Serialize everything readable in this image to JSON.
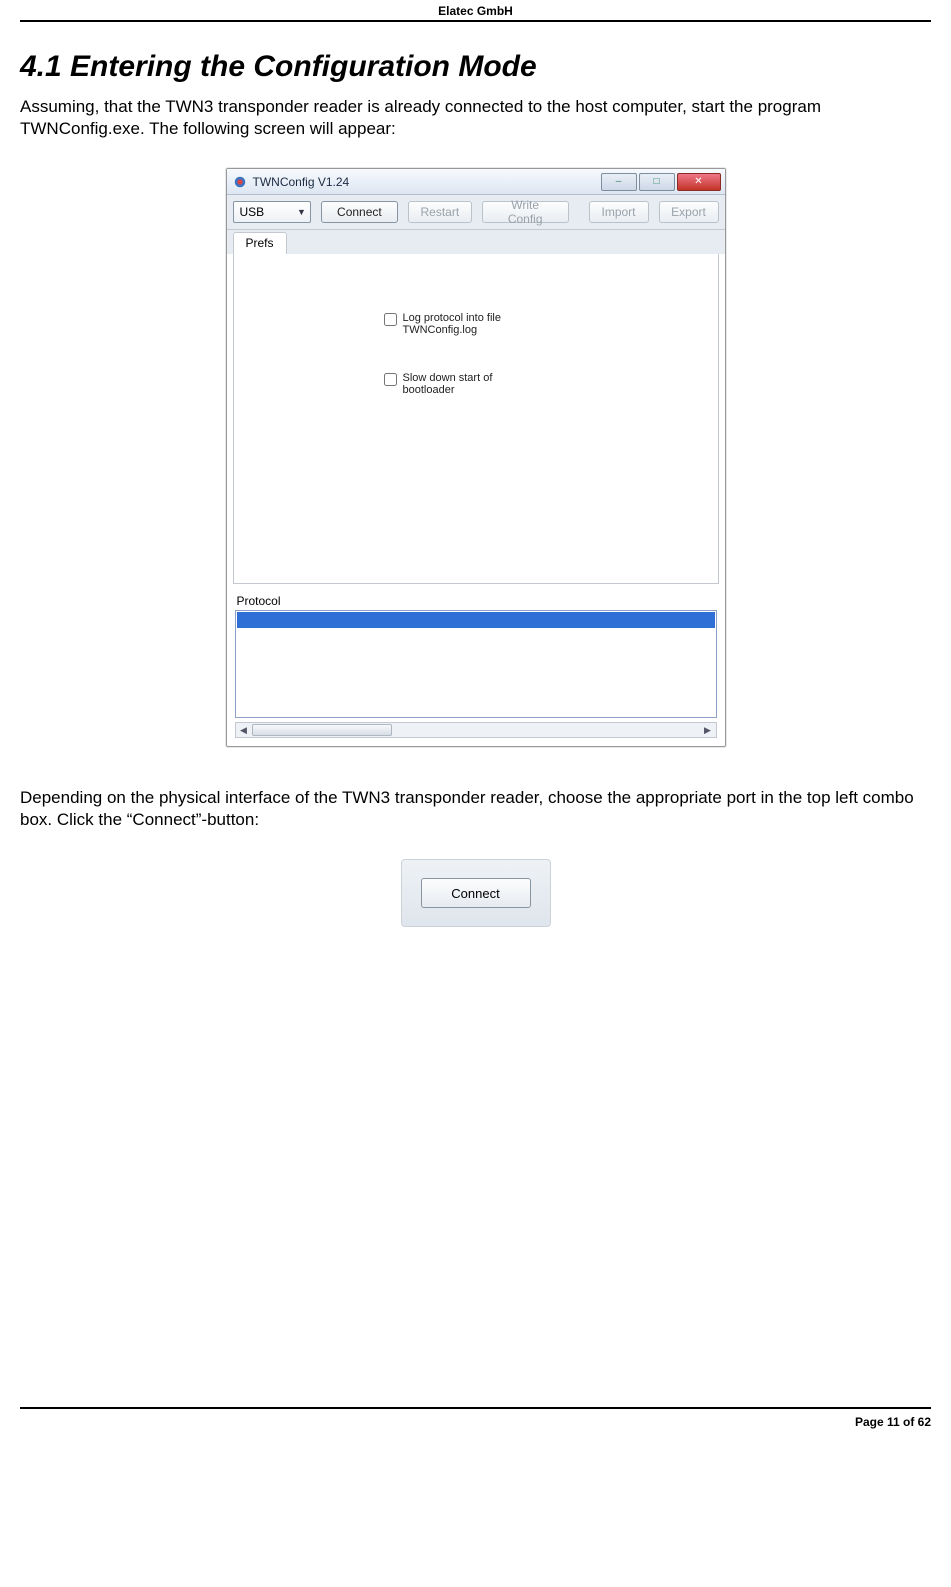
{
  "header": {
    "company": "Elatec GmbH"
  },
  "section": {
    "title": "4.1  Entering the Configuration Mode",
    "paragraph1": "Assuming, that the TWN3 transponder reader is already connected to the host computer, start the program TWNConfig.exe. The following screen will appear:",
    "paragraph2": "Depending on the physical interface of the TWN3 transponder reader, choose the appropriate port in the top left combo box. Click the “Connect”-button:"
  },
  "app": {
    "title": "TWNConfig V1.24",
    "toolbar": {
      "port_value": "USB",
      "connect": "Connect",
      "restart": "Restart",
      "write": "Write Config",
      "import": "Import",
      "export": "Export"
    },
    "tab": {
      "prefs": "Prefs"
    },
    "checkbox1": "Log protocol into file TWNConfig.log",
    "checkbox2": "Slow down start of bootloader",
    "protocol_label": "Protocol"
  },
  "detail": {
    "connect": "Connect"
  },
  "footer": {
    "page": "Page 11 of 62"
  }
}
